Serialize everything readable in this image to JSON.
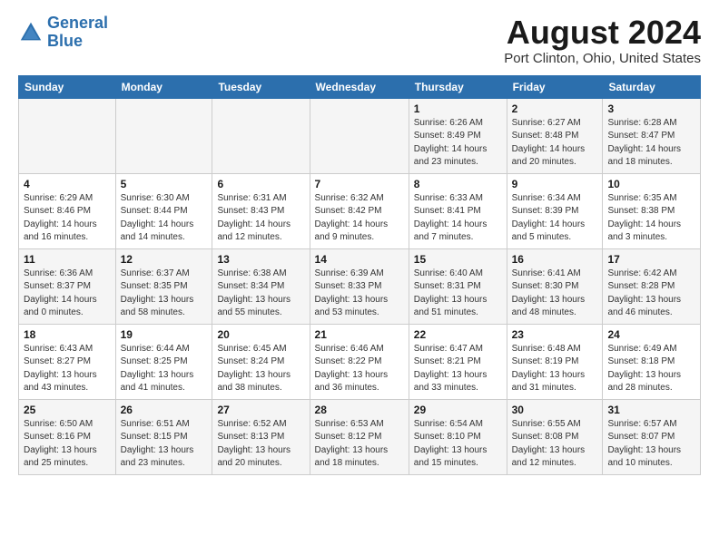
{
  "header": {
    "logo_line1": "General",
    "logo_line2": "Blue",
    "main_title": "August 2024",
    "subtitle": "Port Clinton, Ohio, United States"
  },
  "calendar": {
    "days_of_week": [
      "Sunday",
      "Monday",
      "Tuesday",
      "Wednesday",
      "Thursday",
      "Friday",
      "Saturday"
    ],
    "weeks": [
      [
        {
          "day": "",
          "info": ""
        },
        {
          "day": "",
          "info": ""
        },
        {
          "day": "",
          "info": ""
        },
        {
          "day": "",
          "info": ""
        },
        {
          "day": "1",
          "info": "Sunrise: 6:26 AM\nSunset: 8:49 PM\nDaylight: 14 hours\nand 23 minutes."
        },
        {
          "day": "2",
          "info": "Sunrise: 6:27 AM\nSunset: 8:48 PM\nDaylight: 14 hours\nand 20 minutes."
        },
        {
          "day": "3",
          "info": "Sunrise: 6:28 AM\nSunset: 8:47 PM\nDaylight: 14 hours\nand 18 minutes."
        }
      ],
      [
        {
          "day": "4",
          "info": "Sunrise: 6:29 AM\nSunset: 8:46 PM\nDaylight: 14 hours\nand 16 minutes."
        },
        {
          "day": "5",
          "info": "Sunrise: 6:30 AM\nSunset: 8:44 PM\nDaylight: 14 hours\nand 14 minutes."
        },
        {
          "day": "6",
          "info": "Sunrise: 6:31 AM\nSunset: 8:43 PM\nDaylight: 14 hours\nand 12 minutes."
        },
        {
          "day": "7",
          "info": "Sunrise: 6:32 AM\nSunset: 8:42 PM\nDaylight: 14 hours\nand 9 minutes."
        },
        {
          "day": "8",
          "info": "Sunrise: 6:33 AM\nSunset: 8:41 PM\nDaylight: 14 hours\nand 7 minutes."
        },
        {
          "day": "9",
          "info": "Sunrise: 6:34 AM\nSunset: 8:39 PM\nDaylight: 14 hours\nand 5 minutes."
        },
        {
          "day": "10",
          "info": "Sunrise: 6:35 AM\nSunset: 8:38 PM\nDaylight: 14 hours\nand 3 minutes."
        }
      ],
      [
        {
          "day": "11",
          "info": "Sunrise: 6:36 AM\nSunset: 8:37 PM\nDaylight: 14 hours\nand 0 minutes."
        },
        {
          "day": "12",
          "info": "Sunrise: 6:37 AM\nSunset: 8:35 PM\nDaylight: 13 hours\nand 58 minutes."
        },
        {
          "day": "13",
          "info": "Sunrise: 6:38 AM\nSunset: 8:34 PM\nDaylight: 13 hours\nand 55 minutes."
        },
        {
          "day": "14",
          "info": "Sunrise: 6:39 AM\nSunset: 8:33 PM\nDaylight: 13 hours\nand 53 minutes."
        },
        {
          "day": "15",
          "info": "Sunrise: 6:40 AM\nSunset: 8:31 PM\nDaylight: 13 hours\nand 51 minutes."
        },
        {
          "day": "16",
          "info": "Sunrise: 6:41 AM\nSunset: 8:30 PM\nDaylight: 13 hours\nand 48 minutes."
        },
        {
          "day": "17",
          "info": "Sunrise: 6:42 AM\nSunset: 8:28 PM\nDaylight: 13 hours\nand 46 minutes."
        }
      ],
      [
        {
          "day": "18",
          "info": "Sunrise: 6:43 AM\nSunset: 8:27 PM\nDaylight: 13 hours\nand 43 minutes."
        },
        {
          "day": "19",
          "info": "Sunrise: 6:44 AM\nSunset: 8:25 PM\nDaylight: 13 hours\nand 41 minutes."
        },
        {
          "day": "20",
          "info": "Sunrise: 6:45 AM\nSunset: 8:24 PM\nDaylight: 13 hours\nand 38 minutes."
        },
        {
          "day": "21",
          "info": "Sunrise: 6:46 AM\nSunset: 8:22 PM\nDaylight: 13 hours\nand 36 minutes."
        },
        {
          "day": "22",
          "info": "Sunrise: 6:47 AM\nSunset: 8:21 PM\nDaylight: 13 hours\nand 33 minutes."
        },
        {
          "day": "23",
          "info": "Sunrise: 6:48 AM\nSunset: 8:19 PM\nDaylight: 13 hours\nand 31 minutes."
        },
        {
          "day": "24",
          "info": "Sunrise: 6:49 AM\nSunset: 8:18 PM\nDaylight: 13 hours\nand 28 minutes."
        }
      ],
      [
        {
          "day": "25",
          "info": "Sunrise: 6:50 AM\nSunset: 8:16 PM\nDaylight: 13 hours\nand 25 minutes."
        },
        {
          "day": "26",
          "info": "Sunrise: 6:51 AM\nSunset: 8:15 PM\nDaylight: 13 hours\nand 23 minutes."
        },
        {
          "day": "27",
          "info": "Sunrise: 6:52 AM\nSunset: 8:13 PM\nDaylight: 13 hours\nand 20 minutes."
        },
        {
          "day": "28",
          "info": "Sunrise: 6:53 AM\nSunset: 8:12 PM\nDaylight: 13 hours\nand 18 minutes."
        },
        {
          "day": "29",
          "info": "Sunrise: 6:54 AM\nSunset: 8:10 PM\nDaylight: 13 hours\nand 15 minutes."
        },
        {
          "day": "30",
          "info": "Sunrise: 6:55 AM\nSunset: 8:08 PM\nDaylight: 13 hours\nand 12 minutes."
        },
        {
          "day": "31",
          "info": "Sunrise: 6:57 AM\nSunset: 8:07 PM\nDaylight: 13 hours\nand 10 minutes."
        }
      ]
    ]
  }
}
